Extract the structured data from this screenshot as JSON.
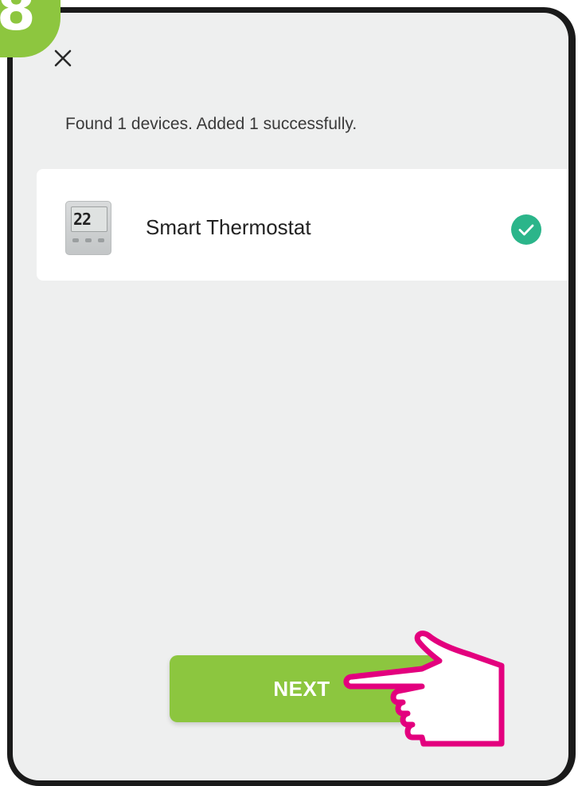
{
  "step": {
    "number": "8"
  },
  "header": {
    "close_icon": "close-icon"
  },
  "status": {
    "text": "Found 1 devices. Added 1 successfully."
  },
  "devices": [
    {
      "name": "Smart Thermostat",
      "display": "22",
      "icon": "thermostat-icon",
      "status_icon": "check-circle-icon"
    }
  ],
  "actions": {
    "next_label": "NEXT"
  },
  "colors": {
    "accent_green": "#8cc63f",
    "check_teal": "#2bb58a",
    "pointer_magenta": "#e3007e",
    "background": "#eeefef"
  }
}
